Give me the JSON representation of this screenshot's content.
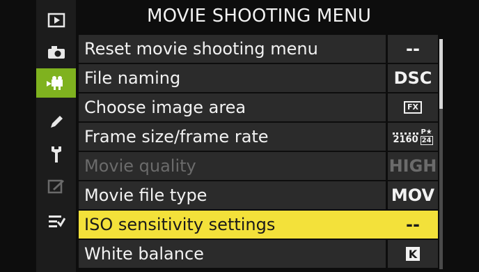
{
  "title": "MOVIE SHOOTING MENU",
  "rail": {
    "items": [
      {
        "icon": "playback-icon"
      },
      {
        "icon": "camera-icon"
      },
      {
        "icon": "movie-camera-icon",
        "active": true
      },
      {
        "icon": "pencil-icon"
      },
      {
        "icon": "wrench-icon"
      },
      {
        "icon": "retouch-icon"
      },
      {
        "icon": "my-menu-icon"
      }
    ],
    "accent_color": "#7fb21f"
  },
  "menu": {
    "items": [
      {
        "label": "Reset movie shooting menu",
        "value": "--"
      },
      {
        "label": "File naming",
        "value": "DSC"
      },
      {
        "label": "Choose image area",
        "value": "FX"
      },
      {
        "label": "Frame size/frame rate",
        "value_main": "2160",
        "value_top": "P★",
        "value_rate": "24"
      },
      {
        "label": "Movie quality",
        "value": "HIGH",
        "disabled": true
      },
      {
        "label": "Movie file type",
        "value": "MOV"
      },
      {
        "label": "ISO sensitivity settings",
        "value": "--",
        "selected": true
      },
      {
        "label": "White balance",
        "value": "K"
      }
    ]
  },
  "colors": {
    "selected_row": "#f3e13a",
    "row_bg": "#2b2b2b",
    "disabled_text": "#6b6b6b"
  }
}
